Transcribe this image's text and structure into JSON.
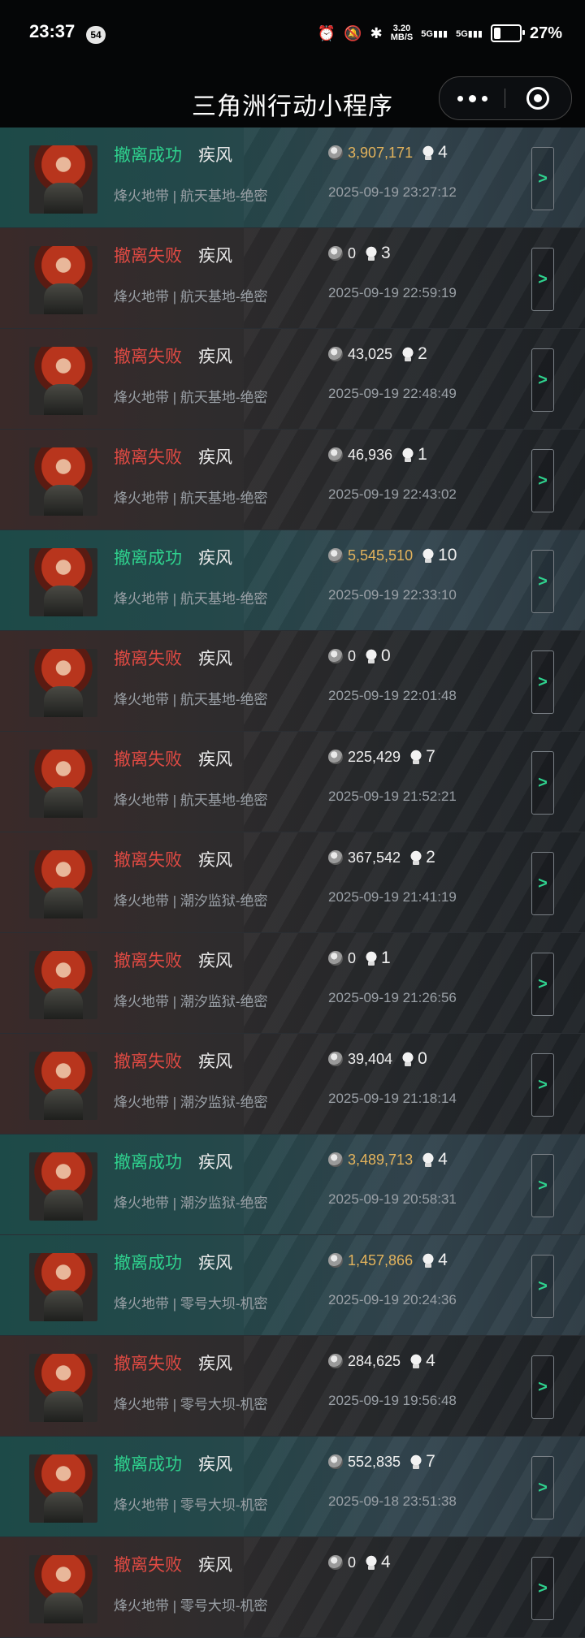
{
  "status_bar": {
    "time": "23:37",
    "notification_badge": "54",
    "net_speed_value": "3.20",
    "net_speed_unit": "MB/S",
    "net_label_1": "5G",
    "net_label_2": "5G",
    "battery_pct": "27%",
    "battery_level": 0.27
  },
  "nav": {
    "title": "三角洲行动小程序"
  },
  "records": [
    {
      "status": "撤离成功",
      "result": "success",
      "hero": "疾风",
      "value": "3,907,171",
      "value_highlight": true,
      "kills": "4",
      "map": "烽火地带 | 航天基地-绝密",
      "datetime": "2025-09-19 23:27:12"
    },
    {
      "status": "撤离失败",
      "result": "fail",
      "hero": "疾风",
      "value": "0",
      "value_highlight": false,
      "kills": "3",
      "map": "烽火地带 | 航天基地-绝密",
      "datetime": "2025-09-19 22:59:19"
    },
    {
      "status": "撤离失败",
      "result": "fail",
      "hero": "疾风",
      "value": "43,025",
      "value_highlight": false,
      "kills": "2",
      "map": "烽火地带 | 航天基地-绝密",
      "datetime": "2025-09-19 22:48:49"
    },
    {
      "status": "撤离失败",
      "result": "fail",
      "hero": "疾风",
      "value": "46,936",
      "value_highlight": false,
      "kills": "1",
      "map": "烽火地带 | 航天基地-绝密",
      "datetime": "2025-09-19 22:43:02"
    },
    {
      "status": "撤离成功",
      "result": "success",
      "hero": "疾风",
      "value": "5,545,510",
      "value_highlight": true,
      "kills": "10",
      "map": "烽火地带 | 航天基地-绝密",
      "datetime": "2025-09-19 22:33:10"
    },
    {
      "status": "撤离失败",
      "result": "fail",
      "hero": "疾风",
      "value": "0",
      "value_highlight": false,
      "kills": "0",
      "map": "烽火地带 | 航天基地-绝密",
      "datetime": "2025-09-19 22:01:48"
    },
    {
      "status": "撤离失败",
      "result": "fail",
      "hero": "疾风",
      "value": "225,429",
      "value_highlight": false,
      "kills": "7",
      "map": "烽火地带 | 航天基地-绝密",
      "datetime": "2025-09-19 21:52:21"
    },
    {
      "status": "撤离失败",
      "result": "fail",
      "hero": "疾风",
      "value": "367,542",
      "value_highlight": false,
      "kills": "2",
      "map": "烽火地带 | 潮汐监狱-绝密",
      "datetime": "2025-09-19 21:41:19"
    },
    {
      "status": "撤离失败",
      "result": "fail",
      "hero": "疾风",
      "value": "0",
      "value_highlight": false,
      "kills": "1",
      "map": "烽火地带 | 潮汐监狱-绝密",
      "datetime": "2025-09-19 21:26:56"
    },
    {
      "status": "撤离失败",
      "result": "fail",
      "hero": "疾风",
      "value": "39,404",
      "value_highlight": false,
      "kills": "0",
      "map": "烽火地带 | 潮汐监狱-绝密",
      "datetime": "2025-09-19 21:18:14"
    },
    {
      "status": "撤离成功",
      "result": "success",
      "hero": "疾风",
      "value": "3,489,713",
      "value_highlight": true,
      "kills": "4",
      "map": "烽火地带 | 潮汐监狱-绝密",
      "datetime": "2025-09-19 20:58:31"
    },
    {
      "status": "撤离成功",
      "result": "success",
      "hero": "疾风",
      "value": "1,457,866",
      "value_highlight": true,
      "kills": "4",
      "map": "烽火地带 | 零号大坝-机密",
      "datetime": "2025-09-19 20:24:36"
    },
    {
      "status": "撤离失败",
      "result": "fail",
      "hero": "疾风",
      "value": "284,625",
      "value_highlight": false,
      "kills": "4",
      "map": "烽火地带 | 零号大坝-机密",
      "datetime": "2025-09-19 19:56:48"
    },
    {
      "status": "撤离成功",
      "result": "success",
      "hero": "疾风",
      "value": "552,835",
      "value_highlight": false,
      "kills": "7",
      "map": "烽火地带 | 零号大坝-机密",
      "datetime": "2025-09-18 23:51:38"
    },
    {
      "status": "撤离失败",
      "result": "fail",
      "hero": "疾风",
      "value": "0",
      "value_highlight": false,
      "kills": "4",
      "map": "烽火地带 | 零号大坝-机密",
      "datetime": ""
    }
  ],
  "row_button_label": ">",
  "colors": {
    "success": "#2fd28e",
    "fail": "#e04a43",
    "gold": "#e3b35c"
  }
}
